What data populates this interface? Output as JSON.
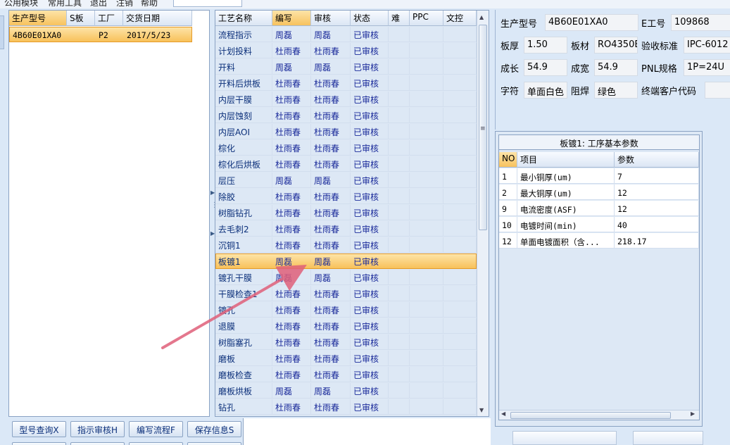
{
  "menu": {
    "items": [
      "公用模块",
      "常用工具",
      "退出",
      "注销",
      "帮助"
    ]
  },
  "order_grid": {
    "columns": [
      "生产型号",
      "S板",
      "工厂",
      "交货日期"
    ],
    "rows": [
      {
        "model": "4B60E01XA0",
        "s_board": "",
        "factory": "P2",
        "delivery_date": "2017/5/23"
      }
    ]
  },
  "process_grid": {
    "columns": [
      "工艺名称",
      "编写",
      "审核",
      "状态",
      "难",
      "PPC",
      "文控"
    ],
    "selected_column": "编写",
    "selected_row": "板镀1",
    "rows": [
      {
        "name": "流程指示",
        "author": "周磊",
        "reviewer": "周磊",
        "status": "已审核"
      },
      {
        "name": "计划投料",
        "author": "杜雨春",
        "reviewer": "杜雨春",
        "status": "已审核"
      },
      {
        "name": "开料",
        "author": "周磊",
        "reviewer": "周磊",
        "status": "已审核"
      },
      {
        "name": "开料后烘板",
        "author": "杜雨春",
        "reviewer": "杜雨春",
        "status": "已审核"
      },
      {
        "name": "内层干膜",
        "author": "杜雨春",
        "reviewer": "杜雨春",
        "status": "已审核"
      },
      {
        "name": "内层蚀刻",
        "author": "杜雨春",
        "reviewer": "杜雨春",
        "status": "已审核"
      },
      {
        "name": "内层AOI",
        "author": "杜雨春",
        "reviewer": "杜雨春",
        "status": "已审核"
      },
      {
        "name": "棕化",
        "author": "杜雨春",
        "reviewer": "杜雨春",
        "status": "已审核"
      },
      {
        "name": "棕化后烘板",
        "author": "杜雨春",
        "reviewer": "杜雨春",
        "status": "已审核"
      },
      {
        "name": "层压",
        "author": "周磊",
        "reviewer": "周磊",
        "status": "已审核"
      },
      {
        "name": "除胶",
        "author": "杜雨春",
        "reviewer": "杜雨春",
        "status": "已审核"
      },
      {
        "name": "树脂钻孔",
        "author": "杜雨春",
        "reviewer": "杜雨春",
        "status": "已审核"
      },
      {
        "name": "去毛刺2",
        "author": "杜雨春",
        "reviewer": "杜雨春",
        "status": "已审核"
      },
      {
        "name": "沉铜1",
        "author": "杜雨春",
        "reviewer": "杜雨春",
        "status": "已审核"
      },
      {
        "name": "板镀1",
        "author": "周磊",
        "reviewer": "周磊",
        "status": "已审核"
      },
      {
        "name": "镀孔干膜",
        "author": "周磊",
        "reviewer": "周磊",
        "status": "已审核"
      },
      {
        "name": "干膜检查1",
        "author": "杜雨春",
        "reviewer": "杜雨春",
        "status": "已审核"
      },
      {
        "name": "镀孔",
        "author": "杜雨春",
        "reviewer": "杜雨春",
        "status": "已审核"
      },
      {
        "name": "退膜",
        "author": "杜雨春",
        "reviewer": "杜雨春",
        "status": "已审核"
      },
      {
        "name": "树脂塞孔",
        "author": "杜雨春",
        "reviewer": "杜雨春",
        "status": "已审核"
      },
      {
        "name": "磨板",
        "author": "杜雨春",
        "reviewer": "杜雨春",
        "status": "已审核"
      },
      {
        "name": "磨板检查",
        "author": "杜雨春",
        "reviewer": "杜雨春",
        "status": "已审核"
      },
      {
        "name": "磨板烘板",
        "author": "周磊",
        "reviewer": "周磊",
        "status": "已审核"
      },
      {
        "name": "钻孔",
        "author": "杜雨春",
        "reviewer": "杜雨春",
        "status": "已审核"
      }
    ]
  },
  "buttons": {
    "model_query": "型号查询X",
    "instruction_review": "指示审核H",
    "edit_flow": "编写流程F",
    "save_info": "保存信息S"
  },
  "info": {
    "model_label": "生产型号",
    "model_value": "4B60E01XA0",
    "e_label": "E工号",
    "e_value": "109868",
    "thickness_label": "板厚",
    "thickness_value": "1.50",
    "material_label": "板材",
    "material_value": "RO4350B",
    "standard_label": "验收标准",
    "standard_value": "IPC-6012",
    "length_label": "成长",
    "length_value": "54.9",
    "width_label": "成宽",
    "width_value": "54.9",
    "pnl_label": "PNL规格",
    "pnl_value": "1P=24U",
    "char_label": "字符",
    "char_value": "单面白色",
    "mask_label": "阻焊",
    "mask_value": "绿色",
    "customer_label": "终端客户代码",
    "customer_value": ""
  },
  "params": {
    "title": "板镀1: 工序基本参数",
    "columns": [
      "NO",
      "项目",
      "参数"
    ],
    "rows": [
      {
        "no": "1",
        "item": "最小铜厚(um)",
        "value": "7"
      },
      {
        "no": "2",
        "item": "最大铜厚(um)",
        "value": "12"
      },
      {
        "no": "9",
        "item": "电流密度(ASF)",
        "value": "12"
      },
      {
        "no": "10",
        "item": "电镀时间(min)",
        "value": "40"
      },
      {
        "no": "12",
        "item": "单面电镀面积（含...",
        "value": "218.17"
      }
    ]
  },
  "colors": {
    "selection": "#f8c15a",
    "annotation_arrow": "#e0607a",
    "header": "#dbe6f4",
    "link_text": "#0b2f7a"
  },
  "icons": [
    "chevron-up-icon",
    "chevron-down-icon",
    "chevron-left-icon",
    "chevron-right-icon"
  ]
}
